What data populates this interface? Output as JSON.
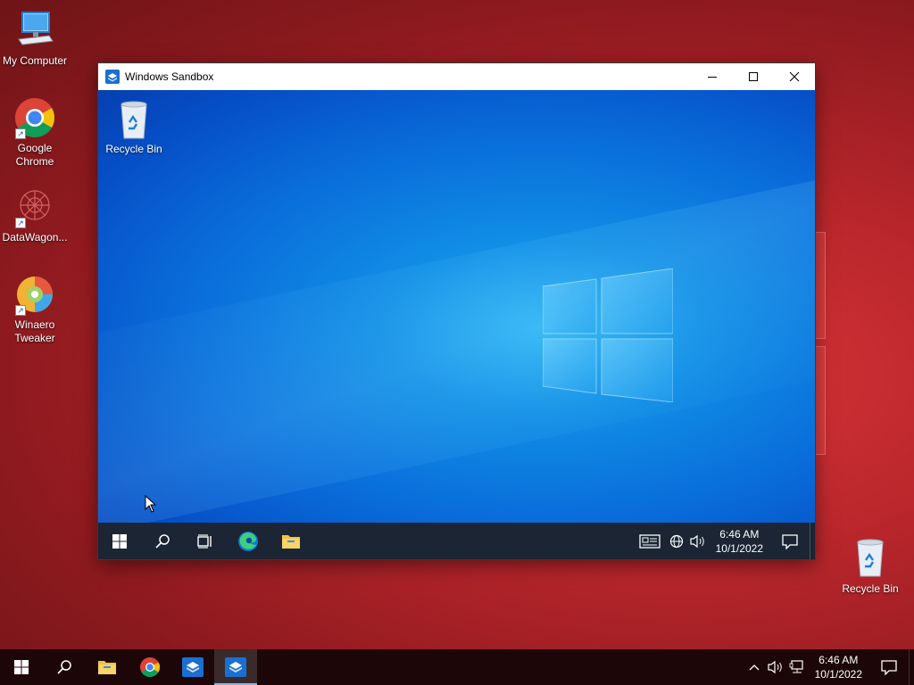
{
  "host_desktop": {
    "icons": [
      {
        "label": "My Computer"
      },
      {
        "label": "Google Chrome"
      },
      {
        "label": "DataWagon..."
      },
      {
        "label": "Winaero Tweaker"
      },
      {
        "label": "Recycle Bin"
      }
    ]
  },
  "window": {
    "title": "Windows Sandbox",
    "buttons": {
      "minimize": "minimize-icon",
      "maximize": "maximize-icon",
      "close": "close-icon"
    }
  },
  "sandbox": {
    "desktop_icons": [
      {
        "label": "Recycle Bin"
      }
    ],
    "taskbar": {
      "pinned": [
        "start-icon",
        "search-icon",
        "task-view-icon",
        "edge-icon",
        "file-explorer-icon"
      ],
      "tray": [
        "news-icon",
        "network-icon",
        "volume-icon"
      ],
      "clock": {
        "time": "6:46 AM",
        "date": "10/1/2022"
      }
    }
  },
  "host_taskbar": {
    "pinned": [
      "start-icon",
      "search-icon",
      "file-explorer-icon",
      "chrome-icon",
      "sandbox-icon",
      "sandbox-icon"
    ],
    "clock": {
      "time": "6:46 AM",
      "date": "10/1/2022"
    }
  },
  "colors": {
    "host_wallpaper": "#b8262b",
    "sandbox_wallpaper": "#0a6fdb",
    "sandbox_taskbar": "#1b2533",
    "host_taskbar": "#1c0608"
  }
}
